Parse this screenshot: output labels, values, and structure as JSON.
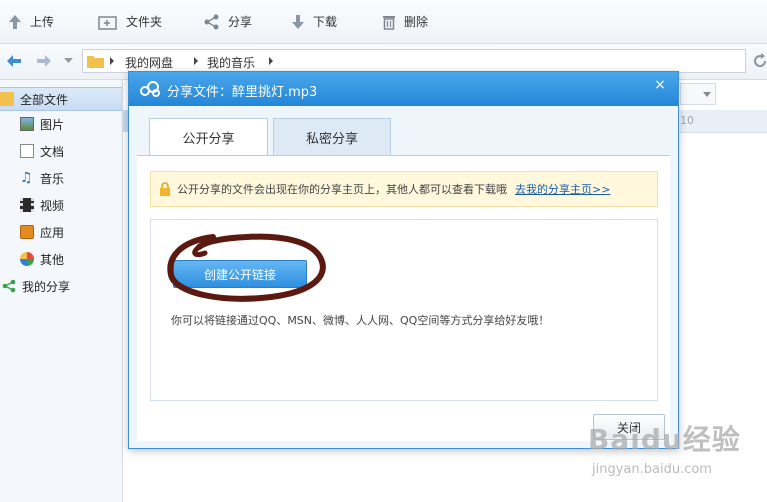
{
  "toolbar": {
    "upload": "上传",
    "new_folder": "文件夹",
    "share": "分享",
    "download": "下载",
    "delete": "删除"
  },
  "breadcrumb": [
    "我的网盘",
    "我的音乐"
  ],
  "sidebar": {
    "items": [
      {
        "label": "全部文件",
        "icon": "folder-icon"
      },
      {
        "label": "图片",
        "icon": "image-icon"
      },
      {
        "label": "文档",
        "icon": "document-icon"
      },
      {
        "label": "音乐",
        "icon": "music-icon"
      },
      {
        "label": "视频",
        "icon": "video-icon"
      },
      {
        "label": "应用",
        "icon": "app-icon"
      },
      {
        "label": "其他",
        "icon": "other-icon"
      },
      {
        "label": "我的分享",
        "icon": "share-icon"
      }
    ]
  },
  "background": {
    "column_fragment": "10"
  },
  "dialog": {
    "title": "分享文件：醉里挑灯.mp3",
    "close_glyph": "×",
    "tabs": [
      "公开分享",
      "私密分享"
    ],
    "notice_text": "公开分享的文件会出现在你的分享主页上，其他人都可以查看下载哦",
    "notice_link": "去我的分享主页>>",
    "create_button": "创建公开链接",
    "hint": "你可以将链接通过QQ、MSN、微博、人人网、QQ空间等方式分享给好友哦！",
    "close_button": "关闭"
  },
  "watermark": {
    "brand": "Baidu经验",
    "url": "jingyan.baidu.com"
  },
  "colors": {
    "title_bar": "#2386d8",
    "annotation": "#5a1a10",
    "button": "#2f8fe0"
  }
}
